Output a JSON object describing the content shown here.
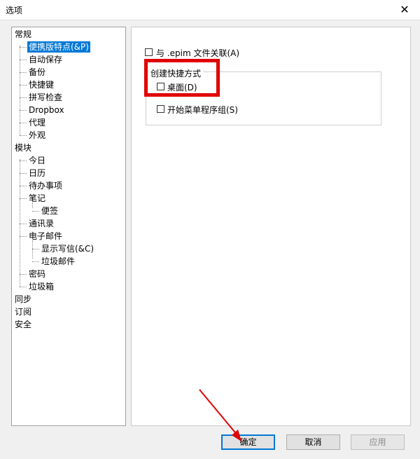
{
  "window": {
    "title": "选项",
    "close_glyph": "✕"
  },
  "tree": {
    "items": [
      {
        "label": "常规"
      },
      {
        "label": "便携版特点(&P)"
      },
      {
        "label": "自动保存"
      },
      {
        "label": "备份"
      },
      {
        "label": "快捷键"
      },
      {
        "label": "拼写检查"
      },
      {
        "label": "Dropbox"
      },
      {
        "label": "代理"
      },
      {
        "label": "外观"
      },
      {
        "label": "模块"
      },
      {
        "label": "今日"
      },
      {
        "label": "日历"
      },
      {
        "label": "待办事项"
      },
      {
        "label": "笔记"
      },
      {
        "label": "便签"
      },
      {
        "label": "通讯录"
      },
      {
        "label": "电子邮件"
      },
      {
        "label": "显示写信(&C)"
      },
      {
        "label": "垃圾邮件"
      },
      {
        "label": "密码"
      },
      {
        "label": "垃圾箱"
      },
      {
        "label": "同步"
      },
      {
        "label": "订阅"
      },
      {
        "label": "安全"
      }
    ],
    "selected": "便携版特点(&P)"
  },
  "panel": {
    "associate_label": "与 .epim 文件关联(A)",
    "shortcut_group_title": "创建快捷方式",
    "desktop_label": "桌面(D)",
    "startmenu_label": "开始菜单程序组(S)"
  },
  "buttons": {
    "ok": "确定",
    "cancel": "取消",
    "apply": "应用"
  },
  "colors": {
    "highlight": "#e00000",
    "selection": "#0078d7"
  }
}
